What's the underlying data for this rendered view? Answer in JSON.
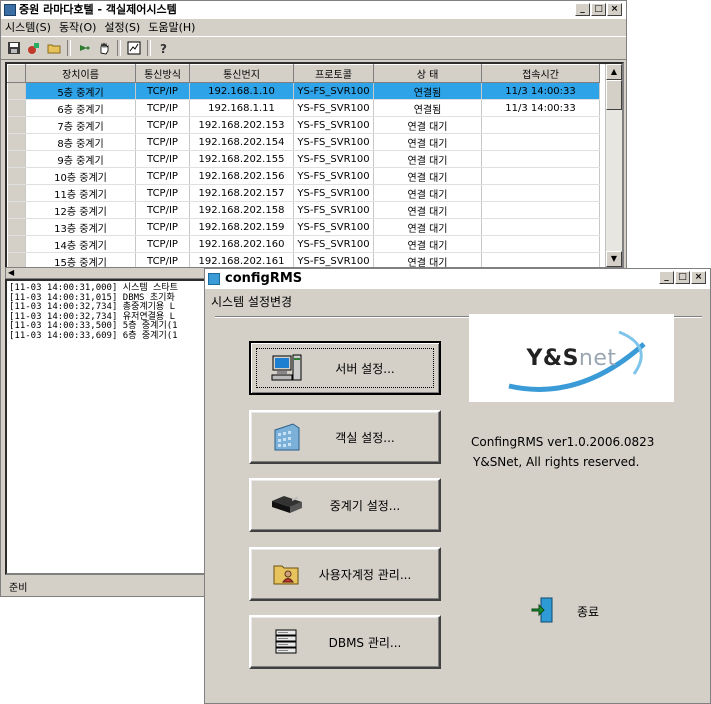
{
  "main_window": {
    "title": "중원 라마다호텔 - 객실제어시스템",
    "menu": [
      "시스템(S)",
      "동작(O)",
      "설정(S)",
      "도움말(H)"
    ],
    "toolbar_icons": [
      "save-icon",
      "tools-icon",
      "open-folder-icon",
      "forward-icon",
      "hand-icon",
      "chart-icon",
      "help-icon"
    ],
    "grid": {
      "columns": [
        "장치이름",
        "통신방식",
        "통신번지",
        "프로토콜",
        "상        태",
        "접속시간"
      ],
      "rows": [
        [
          "5층 중계기",
          "TCP/IP",
          "192.168.1.10",
          "YS-FS_SVR100",
          "연결됨",
          "11/3 14:00:33"
        ],
        [
          "6층 중계기",
          "TCP/IP",
          "192.168.1.11",
          "YS-FS_SVR100",
          "연결됨",
          "11/3 14:00:33"
        ],
        [
          "7층 중계기",
          "TCP/IP",
          "192.168.202.153",
          "YS-FS_SVR100",
          "연결 대기",
          ""
        ],
        [
          "8층 중계기",
          "TCP/IP",
          "192.168.202.154",
          "YS-FS_SVR100",
          "연결 대기",
          ""
        ],
        [
          "9층 중계기",
          "TCP/IP",
          "192.168.202.155",
          "YS-FS_SVR100",
          "연결 대기",
          ""
        ],
        [
          "10층 중계기",
          "TCP/IP",
          "192.168.202.156",
          "YS-FS_SVR100",
          "연결 대기",
          ""
        ],
        [
          "11층 중계기",
          "TCP/IP",
          "192.168.202.157",
          "YS-FS_SVR100",
          "연결 대기",
          ""
        ],
        [
          "12층 중계기",
          "TCP/IP",
          "192.168.202.158",
          "YS-FS_SVR100",
          "연결 대기",
          ""
        ],
        [
          "13층 중계기",
          "TCP/IP",
          "192.168.202.159",
          "YS-FS_SVR100",
          "연결 대기",
          ""
        ],
        [
          "14층 중계기",
          "TCP/IP",
          "192.168.202.160",
          "YS-FS_SVR100",
          "연결 대기",
          ""
        ],
        [
          "15층 중계기",
          "TCP/IP",
          "192.168.202.161",
          "YS-FS_SVR100",
          "연결 대기",
          ""
        ]
      ],
      "selected_row": 0
    },
    "log_lines": [
      "[11-03 14:00:31,000] 시스템 스타트",
      "[11-03 14:00:31,015] DBMS 초기화",
      "[11-03 14:00:32,734] 총중계기용 L",
      "[11-03 14:00:32,734] 유저연결용 L",
      "[11-03 14:00:33,500] 5층 중계기(1",
      "[11-03 14:00:33,609] 6층 중계기(1"
    ],
    "status": "준비"
  },
  "config_dialog": {
    "title": "configRMS",
    "subtitle": "시스템 설정변경",
    "buttons": [
      {
        "label": "서버 설정...",
        "icon": "computer-icon"
      },
      {
        "label": "객실 설정...",
        "icon": "building-icon"
      },
      {
        "label": "중계기 설정...",
        "icon": "device-icon"
      },
      {
        "label": "사용자계정 관리...",
        "icon": "user-folder-icon"
      },
      {
        "label": "DBMS 관리...",
        "icon": "database-icon"
      }
    ],
    "logo_text_bold": "Y&S",
    "logo_text_light": "net",
    "version": "ConfingRMS ver1.0.2006.0823",
    "copyright": "Y&SNet, All rights reserved.",
    "exit_label": "종료"
  },
  "window_controls": {
    "minimize": "_",
    "maximize": "□",
    "close": "×"
  },
  "colors": {
    "selection": "#2ea3e8",
    "face": "#d4d0c8",
    "logo_swoosh": "#3a9bd7"
  }
}
